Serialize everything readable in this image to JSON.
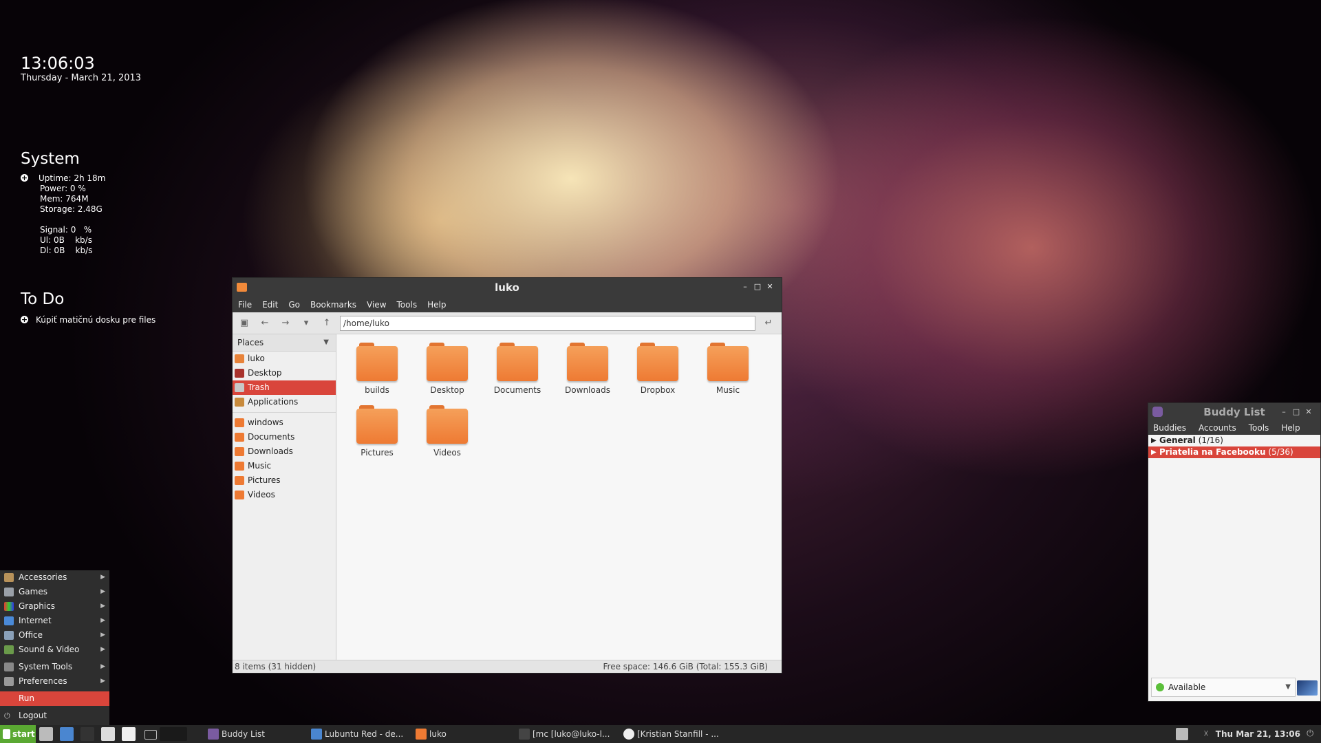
{
  "clock": {
    "time": "13:06:03",
    "date": "Thursday - March 21, 2013"
  },
  "system": {
    "title": "System",
    "rows": [
      "Uptime: 2h 18m",
      "Power: 0 %",
      "Mem: 764M",
      "Storage: 2.48G",
      "Signal: 0   %",
      "Ul: 0B    kb/s",
      "Dl: 0B    kb/s"
    ]
  },
  "todo": {
    "title": "To Do",
    "item": "Kúpiť matičnú dosku pre files"
  },
  "file_manager": {
    "title": "luko",
    "menu": [
      "File",
      "Edit",
      "Go",
      "Bookmarks",
      "View",
      "Tools",
      "Help"
    ],
    "path": "/home/luko",
    "places_header": "Places",
    "places": [
      {
        "label": "luko",
        "icon": "home-icon",
        "color": "#e8833a"
      },
      {
        "label": "Desktop",
        "icon": "desktop-icon",
        "color": "#a8322c"
      },
      {
        "label": "Trash",
        "icon": "trash-icon",
        "color": "#c8c8c8"
      },
      {
        "label": "Applications",
        "icon": "applications-icon",
        "color": "#c88a3c"
      }
    ],
    "bookmarks": [
      {
        "label": "windows"
      },
      {
        "label": "Documents"
      },
      {
        "label": "Downloads"
      },
      {
        "label": "Music"
      },
      {
        "label": "Pictures"
      },
      {
        "label": "Videos"
      }
    ],
    "folders": [
      "builds",
      "Desktop",
      "Documents",
      "Downloads",
      "Dropbox",
      "Music",
      "Pictures",
      "Videos"
    ],
    "status_left": "8 items (31 hidden)",
    "status_right": "Free space: 146.6 GiB (Total: 155.3 GiB)"
  },
  "buddy_list": {
    "title": "Buddy List",
    "menu": [
      "Buddies",
      "Accounts",
      "Tools",
      "Help"
    ],
    "groups": [
      {
        "name": "General",
        "count": "(1/16)"
      },
      {
        "name": "Priatelia na Facebooku",
        "count": "(5/36)"
      }
    ],
    "status": "Available"
  },
  "start_menu": {
    "items": [
      "Accessories",
      "Games",
      "Graphics",
      "Internet",
      "Office",
      "Sound & Video",
      "System Tools",
      "Preferences",
      "Run",
      "Logout"
    ]
  },
  "taskbar": {
    "start": "start",
    "tasks": [
      "Buddy List",
      "Lubuntu Red - de...",
      "luko",
      "[mc [luko@luko-l...",
      "[Kristian Stanfill - ..."
    ],
    "clock": "Thu Mar 21, 13:06"
  },
  "colors": {
    "accent": "#d9453b",
    "folder": "#ee7a33",
    "start_green": "#5aa832"
  }
}
